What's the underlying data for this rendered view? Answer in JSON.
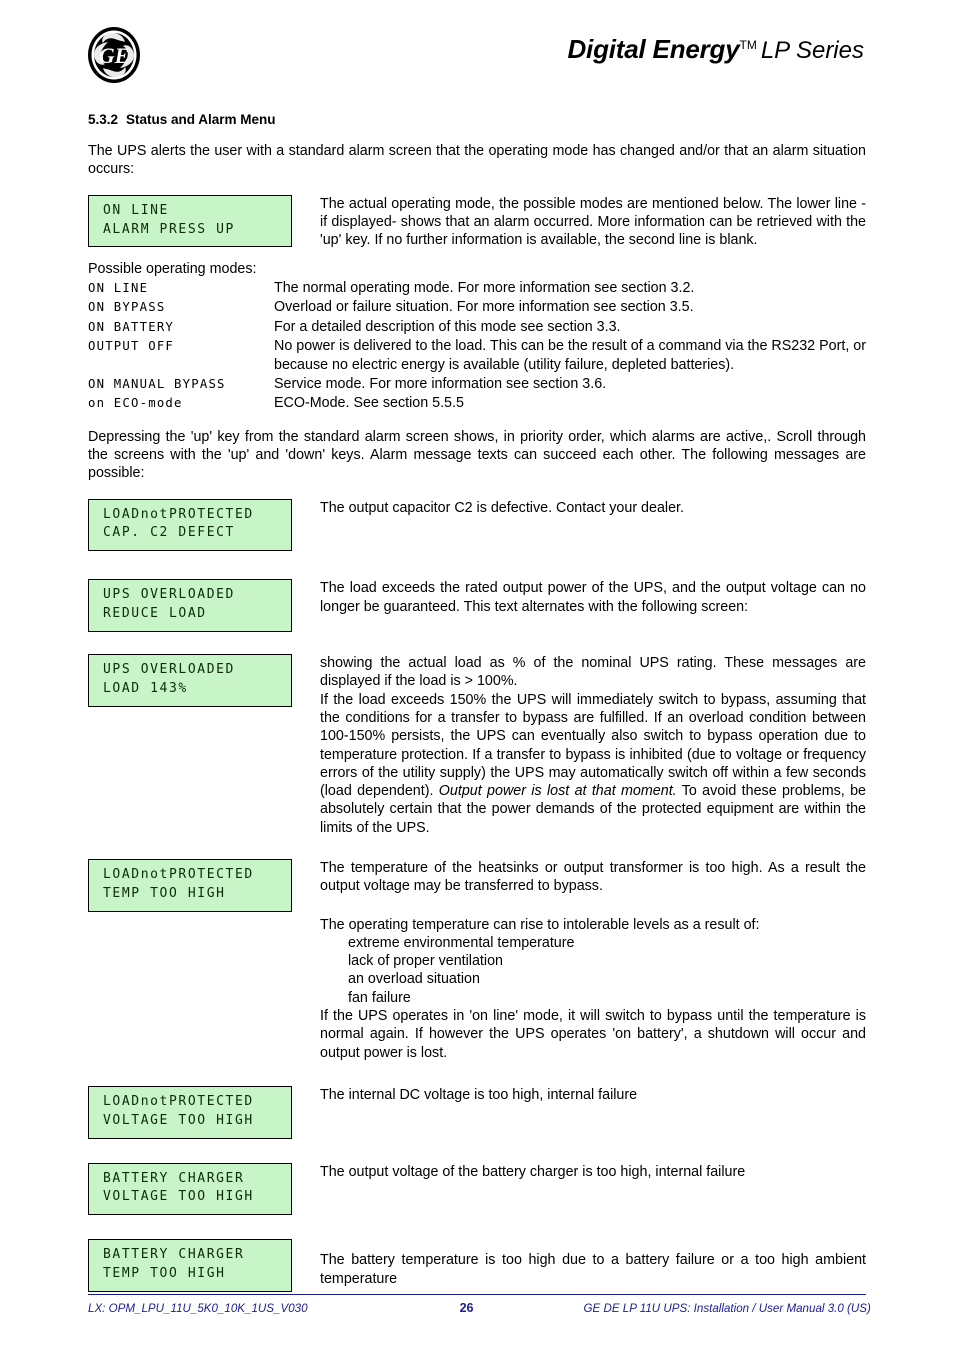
{
  "header": {
    "logo_name": "ge-monogram-logo",
    "brand_main": "Digital Energy",
    "brand_tm": "TM",
    "brand_sub": "LP Series"
  },
  "section": {
    "number": "5.3.2",
    "title": "Status and Alarm Menu",
    "intro": "The UPS alerts the user with a standard alarm screen that the operating mode has changed and/or that an alarm situation occurs:"
  },
  "standard_alarm": {
    "lcd_line1": "ON LINE",
    "lcd_line2": "ALARM PRESS UP",
    "description": "The actual operating mode, the possible modes are mentioned below. The lower line -if displayed- shows that an alarm occurred. More information can be retrieved with the 'up' key. If no further information is available, the second line is blank."
  },
  "modes": {
    "label": "Possible operating modes:",
    "rows": [
      {
        "code": "ON LINE",
        "desc": "The normal operating mode. For more information see section 3.2."
      },
      {
        "code": "ON BYPASS",
        "desc": "Overload or failure situation. For more information see section 3.5."
      },
      {
        "code": "ON BATTERY",
        "desc": "For a detailed description of this mode see section 3.3."
      },
      {
        "code": "OUTPUT OFF",
        "desc": "No power is delivered to the load. This can be the result of a command via the RS232 Port, or because no electric energy is available (utility failure, depleted batteries)."
      },
      {
        "code": "ON MANUAL BYPASS",
        "desc": "Service mode. For more information see section 3.6."
      },
      {
        "code": "on ECO-mode",
        "desc": "ECO-Mode. See section 5.5.5"
      }
    ]
  },
  "scroll_paragraph": "Depressing the 'up' key from the standard alarm screen shows, in priority order, which alarms are active,. Scroll through the screens with the 'up' and 'down' keys. Alarm message texts can succeed each other. The following messages are possible:",
  "alarms": {
    "cap_defect": {
      "lcd_line1": "LOADnotPROTECTED",
      "lcd_line2": "CAP. C2 DEFECT",
      "desc": "The output capacitor C2 is defective. Contact your dealer."
    },
    "overload_reduce": {
      "lcd_line1": "UPS OVERLOADED",
      "lcd_line2": "REDUCE LOAD",
      "desc": "The load exceeds the rated output power of the UPS, and the output voltage can no longer be guaranteed. This text alternates with the following screen:"
    },
    "overload_percent": {
      "lcd_line1": "UPS OVERLOADED",
      "lcd_line2": "LOAD 143%",
      "desc_p1": "showing the actual load as % of the nominal UPS rating. These messages are displayed if the load is > 100%.",
      "desc_p2_a": "If the load exceeds 150% the UPS will immediately switch to bypass, assuming that the conditions for a transfer to bypass are fulfilled. If an overload condition between 100-150% persists, the UPS can eventually also switch to bypass operation due to temperature protection. If a transfer to bypass is inhibited (due to voltage or frequency errors of the utility supply) the UPS may automatically switch off within a few seconds (load dependent). ",
      "desc_p2_em": "Output power is lost at that moment.",
      "desc_p2_b": " To avoid these problems, be absolutely certain that the power demands of the protected equipment are within the limits of the UPS."
    },
    "temp_too_high": {
      "lcd_line1": "LOADnotPROTECTED",
      "lcd_line2": "TEMP TOO HIGH",
      "desc_p1": "The temperature of the heatsinks or output transformer is too high. As a result the output voltage may be transferred to bypass.",
      "desc_p2": "The operating temperature can rise to intolerable levels as a result of:",
      "causes": [
        "extreme environmental temperature",
        "lack of proper ventilation",
        "an overload situation",
        "fan failure"
      ],
      "desc_p3": "If the UPS operates in 'on line' mode, it will switch to bypass until the temperature is normal again. If however the UPS operates 'on battery', a shutdown will occur and output power is lost."
    },
    "voltage_too_high": {
      "lcd_line1": "LOADnotPROTECTED",
      "lcd_line2": "VOLTAGE TOO HIGH",
      "desc": "The internal DC voltage is too high, internal failure"
    },
    "charger_voltage": {
      "lcd_line1": "BATTERY CHARGER",
      "lcd_line2": "VOLTAGE TOO HIGH",
      "desc": "The output voltage of the battery charger is too high, internal failure"
    },
    "charger_temp": {
      "lcd_line1": "BATTERY CHARGER",
      "lcd_line2": "TEMP TOO HIGH",
      "desc": "The battery temperature is too high due to a battery failure or a too high ambient temperature"
    }
  },
  "footer": {
    "left": "LX: OPM_LPU_11U_5K0_10K_1US_V030",
    "page": "26",
    "right": "GE DE LP 11U UPS: Installation / User Manual 3.0 (US)",
    "accent_color": "#1d1d96"
  },
  "colors": {
    "lcd_background": "#c8f5c8",
    "lcd_text": "#0d2b0d",
    "lcd_border": "#000000"
  }
}
